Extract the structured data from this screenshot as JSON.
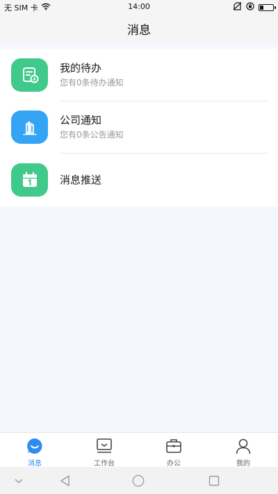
{
  "status_bar": {
    "carrier": "无 SIM 卡",
    "time": "14:00",
    "battery_level": 0.3
  },
  "header": {
    "title": "消息"
  },
  "messages": [
    {
      "title": "我的待办",
      "subtitle": "您有0条待办通知",
      "icon": "todo-doc-icon",
      "color": "#3fc98a"
    },
    {
      "title": "公司通知",
      "subtitle": "您有0条公告通知",
      "icon": "building-icon",
      "color": "#34a4f4"
    },
    {
      "title": "消息推送",
      "subtitle": "",
      "icon": "calendar-icon",
      "color": "#3fc98a"
    }
  ],
  "tabs": [
    {
      "label": "消息",
      "icon": "chat-icon",
      "active": true
    },
    {
      "label": "工作台",
      "icon": "monitor-icon",
      "active": false
    },
    {
      "label": "办公",
      "icon": "briefcase-icon",
      "active": false
    },
    {
      "label": "我的",
      "icon": "person-icon",
      "active": false
    }
  ],
  "colors": {
    "accent": "#2e8bf0",
    "green": "#3fc98a",
    "blue": "#34a4f4",
    "background": "#f4f7fc"
  },
  "system_nav": {
    "icons": [
      "chevron-down-icon",
      "back-icon",
      "home-icon",
      "recent-apps-icon"
    ]
  }
}
